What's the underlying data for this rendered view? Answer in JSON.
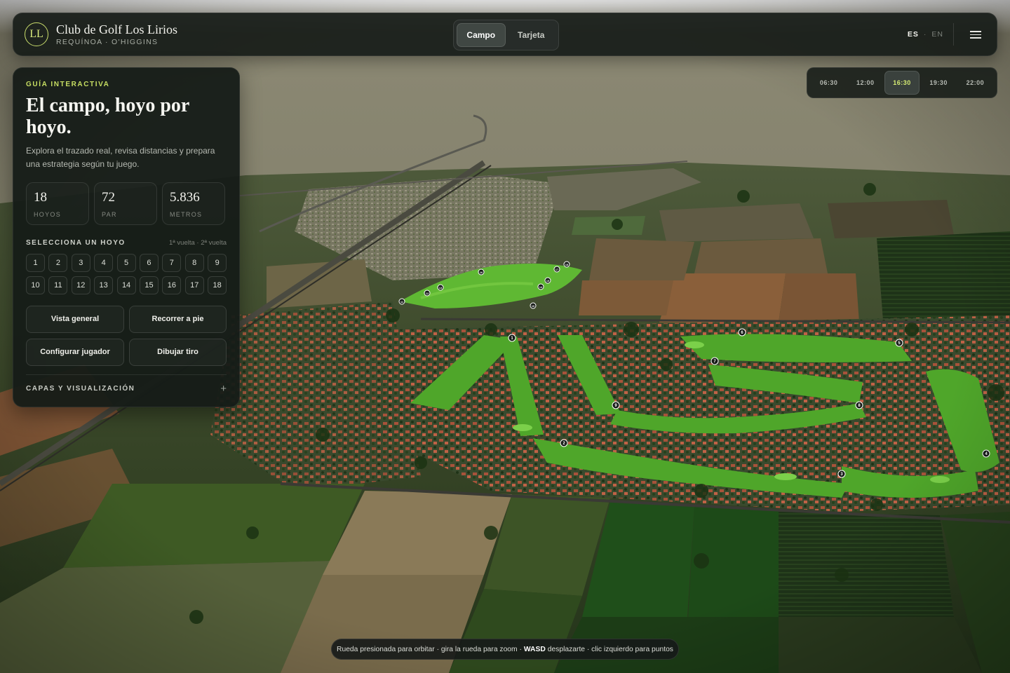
{
  "header": {
    "monogram": "LL",
    "club_name": "Club de Golf Los Lirios",
    "location": "REQUÍNOA · O'HIGGINS",
    "tabs": [
      {
        "label": "Campo",
        "active": true
      },
      {
        "label": "Tarjeta",
        "active": false
      }
    ],
    "lang_active": "ES",
    "lang_sep": "·",
    "lang_inactive": "EN",
    "menu_icon": "hamburger-menu-icon"
  },
  "times": [
    {
      "label": "06:30",
      "active": false
    },
    {
      "label": "12:00",
      "active": false
    },
    {
      "label": "16:30",
      "active": true
    },
    {
      "label": "19:30",
      "active": false
    },
    {
      "label": "22:00",
      "active": false
    }
  ],
  "panel": {
    "eyebrow": "GUÍA INTERACTIVA",
    "title": "El campo, hoyo por hoyo.",
    "description": "Explora el trazado real, revisa distancias y prepara una estrategia según tu juego.",
    "stats": [
      {
        "value": "18",
        "label": "HOYOS"
      },
      {
        "value": "72",
        "label": "PAR"
      },
      {
        "value": "5.836",
        "label": "METROS"
      }
    ],
    "select_title": "SELECCIONA UN HOYO",
    "select_note": "1ª vuelta · 2ª vuelta",
    "holes": [
      "1",
      "2",
      "3",
      "4",
      "5",
      "6",
      "7",
      "8",
      "9",
      "10",
      "11",
      "12",
      "13",
      "14",
      "15",
      "16",
      "17",
      "18"
    ],
    "actions": {
      "overview": "Vista general",
      "walk": "Recorrer a pie",
      "player": "Configurar jugador",
      "shot": "Dibujar tiro"
    },
    "layers_label": "CAPAS Y VISUALIZACIÓN",
    "layers_toggle": "+"
  },
  "hint": {
    "part1": "Rueda presionada para orbitar · gira la rueda para zoom ·",
    "key": "WASD",
    "part2": "desplazarte · clic izquierdo para puntos"
  },
  "map": {
    "hole_markers": [
      "1",
      "2",
      "3",
      "4",
      "5",
      "6",
      "7",
      "8",
      "9",
      "10",
      "11",
      "12",
      "13",
      "14",
      "15",
      "16",
      "17",
      "18"
    ],
    "colors": {
      "sky": "#8a8670",
      "fairway": "#4fa62a",
      "accent": "#d6ec73"
    }
  }
}
